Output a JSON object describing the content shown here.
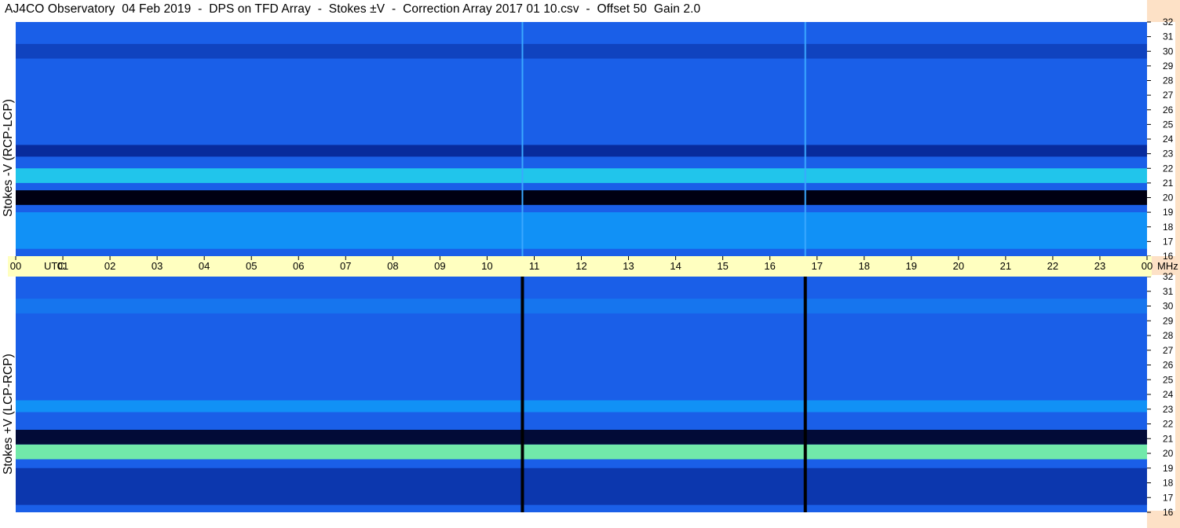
{
  "title": "AJ4CO Observatory  04 Feb 2019  -  DPS on TFD Array  -  Stokes ±V  -  Correction Array 2017 01 10.csv  -  Offset 50  Gain 2.0",
  "colors": {
    "time_axis_bg": "#ffffc0",
    "right_strip": "#fde1c6",
    "accent_blue": "#1a5fe8"
  },
  "chart_data": [
    {
      "type": "heatmap",
      "panel": "top",
      "ylabel": "Stokes -V (RCP-LCP)",
      "y_unit": "MHz",
      "ylim": [
        16,
        32
      ],
      "yticks": [
        "32",
        "31",
        "30",
        "29",
        "28",
        "27",
        "26",
        "25",
        "24",
        "23",
        "22",
        "21",
        "20",
        "19",
        "18",
        "17",
        "16"
      ],
      "xlim": [
        0,
        24
      ],
      "bands": [
        {
          "freq": [
            29.5,
            30.5
          ],
          "level": 0.3
        },
        {
          "freq": [
            22.8,
            23.6
          ],
          "level": 0.2
        },
        {
          "freq": [
            21.0,
            22.0
          ],
          "level": 0.75
        },
        {
          "freq": [
            19.5,
            20.5
          ],
          "level": 0.0
        },
        {
          "freq": [
            16.5,
            19.0
          ],
          "level": 0.6
        }
      ],
      "vertical_lines_utc": [
        10.75,
        16.75
      ]
    },
    {
      "type": "heatmap",
      "panel": "bottom",
      "ylabel": "Stokes +V (LCP-RCP)",
      "y_unit": "MHz",
      "ylim": [
        16,
        32
      ],
      "yticks": [
        "32",
        "31",
        "30",
        "29",
        "28",
        "27",
        "26",
        "25",
        "24",
        "23",
        "22",
        "21",
        "20",
        "19",
        "18",
        "17",
        "16"
      ],
      "xlim": [
        0,
        24
      ],
      "bands": [
        {
          "freq": [
            29.5,
            30.5
          ],
          "level": 0.5
        },
        {
          "freq": [
            22.8,
            23.6
          ],
          "level": 0.6
        },
        {
          "freq": [
            20.6,
            21.6
          ],
          "level": 0.05
        },
        {
          "freq": [
            19.6,
            20.6
          ],
          "level": 0.9
        },
        {
          "freq": [
            16.5,
            19.0
          ],
          "level": 0.25
        }
      ],
      "vertical_lines_utc": [
        10.75,
        16.75
      ]
    }
  ],
  "time_axis": {
    "labels": [
      "00",
      "01",
      "02",
      "03",
      "04",
      "05",
      "06",
      "07",
      "08",
      "09",
      "10",
      "11",
      "12",
      "13",
      "14",
      "15",
      "16",
      "17",
      "18",
      "19",
      "20",
      "21",
      "22",
      "23",
      "00"
    ],
    "utc_label": "UTC",
    "mhz_label": "MHz"
  }
}
